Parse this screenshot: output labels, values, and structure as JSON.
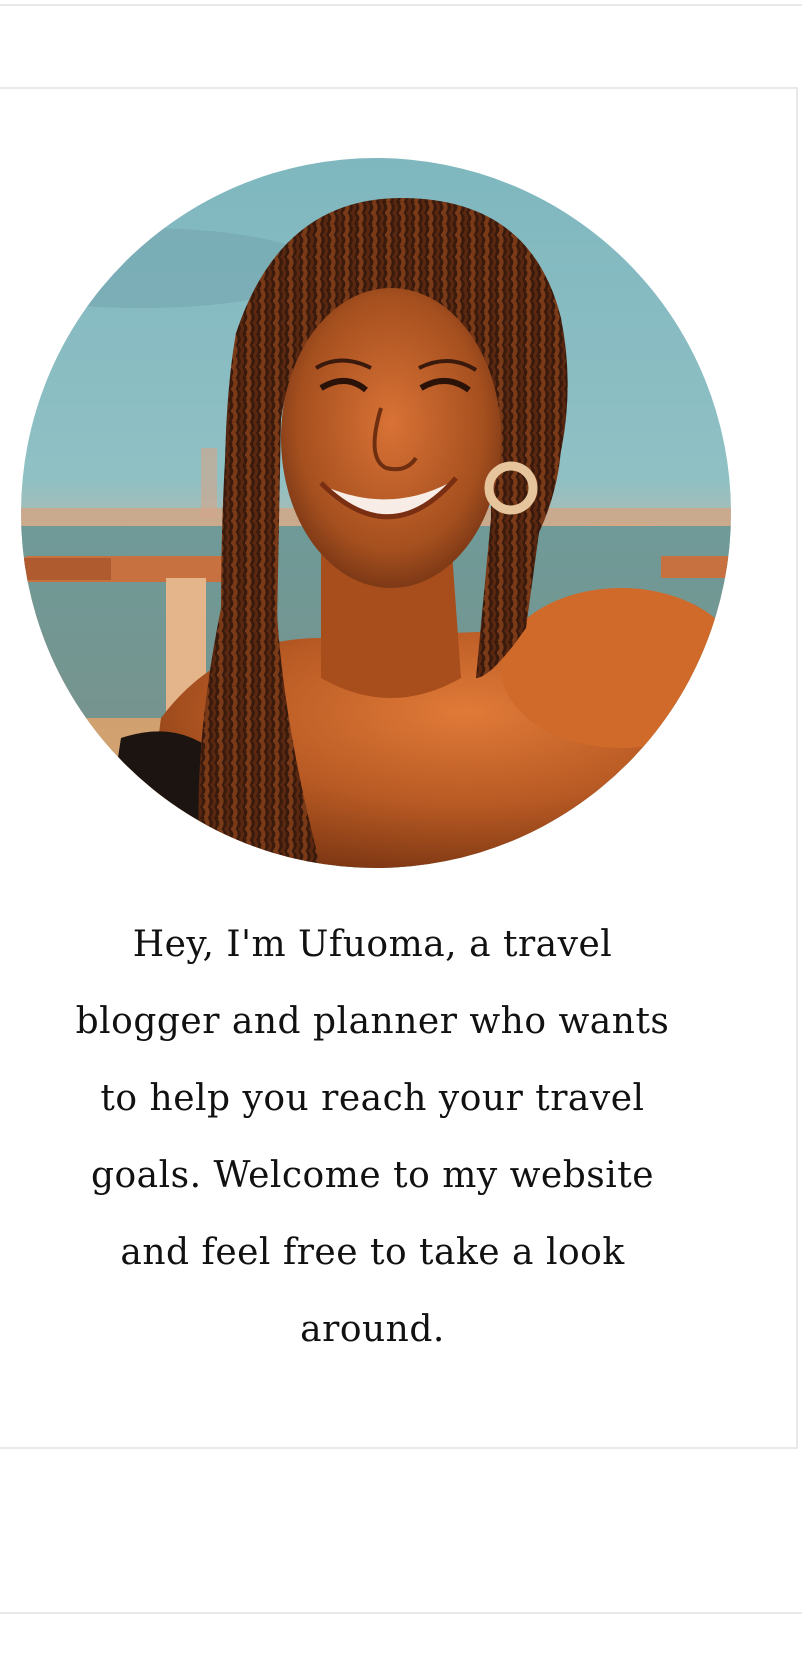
{
  "profile": {
    "photo_description": "Portrait photo in circle frame",
    "bio_text": "Hey, I'm Ufuoma, a travel blogger and planner who wants to help you reach your travel goals. Welcome to my website and feel free to take a look around."
  }
}
